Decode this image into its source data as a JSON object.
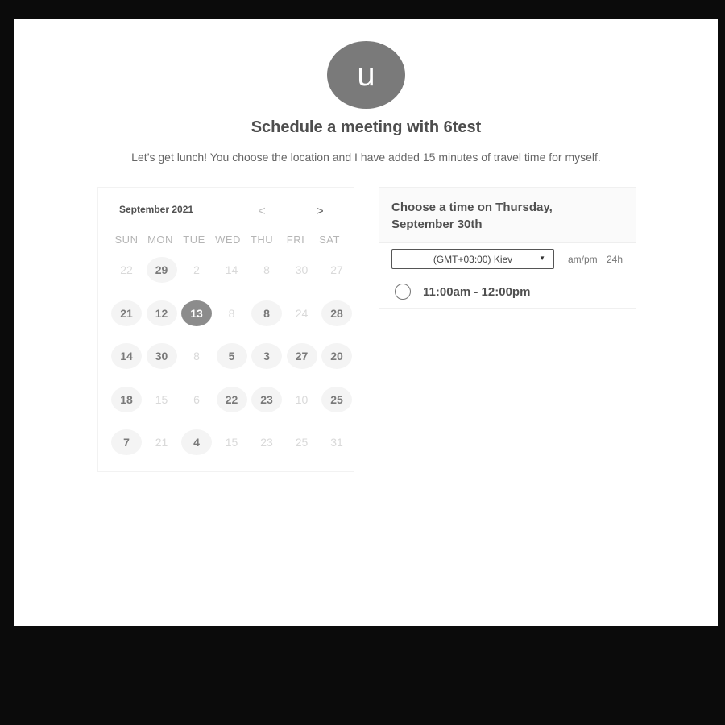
{
  "avatar": {
    "letter": "u"
  },
  "title": "Schedule a meeting with 6test",
  "description": "Let’s get lunch! You choose the location and I have added 15 minutes of travel time for myself.",
  "calendar": {
    "month": "September 2021",
    "prev_icon": "chevron-left-icon",
    "next_icon": "chevron-right-icon",
    "weekdays": [
      "SUN",
      "MON",
      "TUE",
      "WED",
      "THU",
      "FRI",
      "SAT"
    ],
    "weeks": [
      [
        {
          "d": "22",
          "s": "disabled"
        },
        {
          "d": "29",
          "s": "available"
        },
        {
          "d": "2",
          "s": "disabled"
        },
        {
          "d": "14",
          "s": "disabled"
        },
        {
          "d": "8",
          "s": "disabled"
        },
        {
          "d": "30",
          "s": "disabled"
        },
        {
          "d": "27",
          "s": "disabled"
        }
      ],
      [
        {
          "d": "21",
          "s": "available"
        },
        {
          "d": "12",
          "s": "available"
        },
        {
          "d": "13",
          "s": "selected"
        },
        {
          "d": "8",
          "s": "disabled"
        },
        {
          "d": "8",
          "s": "available"
        },
        {
          "d": "24",
          "s": "disabled"
        },
        {
          "d": "28",
          "s": "available"
        }
      ],
      [
        {
          "d": "14",
          "s": "available"
        },
        {
          "d": "30",
          "s": "available"
        },
        {
          "d": "8",
          "s": "disabled"
        },
        {
          "d": "5",
          "s": "available"
        },
        {
          "d": "3",
          "s": "available"
        },
        {
          "d": "27",
          "s": "available"
        },
        {
          "d": "20",
          "s": "available"
        }
      ],
      [
        {
          "d": "18",
          "s": "available"
        },
        {
          "d": "15",
          "s": "disabled"
        },
        {
          "d": "6",
          "s": "disabled"
        },
        {
          "d": "22",
          "s": "available"
        },
        {
          "d": "23",
          "s": "available"
        },
        {
          "d": "10",
          "s": "disabled"
        },
        {
          "d": "25",
          "s": "available"
        }
      ],
      [
        {
          "d": "7",
          "s": "available"
        },
        {
          "d": "21",
          "s": "disabled"
        },
        {
          "d": "4",
          "s": "available"
        },
        {
          "d": "15",
          "s": "disabled"
        },
        {
          "d": "23",
          "s": "disabled"
        },
        {
          "d": "25",
          "s": "disabled"
        },
        {
          "d": "31",
          "s": "disabled"
        }
      ]
    ]
  },
  "times": {
    "heading": "Choose a time on Thursday, September 30th",
    "timezone": "(GMT+03:00) Kiev",
    "timezone_icon": "caret-down-icon",
    "format_ampm": "am/pm",
    "format_24h": "24h",
    "slots": [
      "11:00am - 12:00pm"
    ]
  },
  "colors": {
    "avatar_bg": "#7a7a7a",
    "selected_day_bg": "#8c8c8c",
    "available_day_bg": "#f4f4f4",
    "frame_bg": "#0b0b0b"
  }
}
